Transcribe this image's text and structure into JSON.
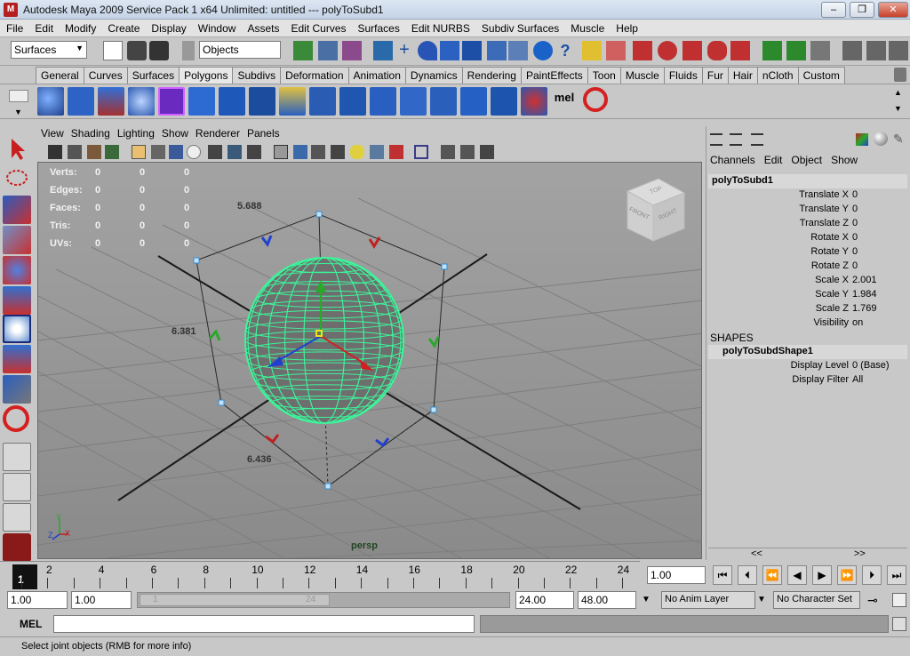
{
  "window": {
    "title": "Autodesk Maya 2009 Service Pack 1 x64 Unlimited: untitled   ---   polyToSubd1",
    "controls": [
      "–",
      "❒",
      "✕"
    ]
  },
  "menubar": [
    "File",
    "Edit",
    "Modify",
    "Create",
    "Display",
    "Window",
    "Assets",
    "Edit Curves",
    "Surfaces",
    "Edit NURBS",
    "Subdiv Surfaces",
    "Muscle",
    "Help"
  ],
  "statusline": {
    "menuset": "Surfaces",
    "selection_mode": "Objects"
  },
  "shelf": {
    "tabs": [
      "General",
      "Curves",
      "Surfaces",
      "Polygons",
      "Subdivs",
      "Deformation",
      "Animation",
      "Dynamics",
      "Rendering",
      "PaintEffects",
      "Toon",
      "Muscle",
      "Fluids",
      "Fur",
      "Hair",
      "nCloth",
      "Custom"
    ],
    "active_tab": "Polygons",
    "mel_label": "mel"
  },
  "viewport": {
    "menus": [
      "View",
      "Shading",
      "Lighting",
      "Show",
      "Renderer",
      "Panels"
    ],
    "hud": {
      "rows": [
        {
          "label": "Verts:",
          "values": [
            "0",
            "0",
            "0"
          ]
        },
        {
          "label": "Edges:",
          "values": [
            "0",
            "0",
            "0"
          ]
        },
        {
          "label": "Faces:",
          "values": [
            "0",
            "0",
            "0"
          ]
        },
        {
          "label": "Tris:",
          "values": [
            "0",
            "0",
            "0"
          ]
        },
        {
          "label": "UVs:",
          "values": [
            "0",
            "0",
            "0"
          ]
        }
      ]
    },
    "dimensions": {
      "width": "5.688",
      "height": "6.381",
      "depth": "6.436"
    },
    "camera_name": "persp",
    "viewcube": {
      "top": "TOP",
      "front": "FRONT",
      "right": "RIGHT"
    },
    "axis": {
      "x": "X",
      "y": "Y",
      "z": "Z"
    }
  },
  "channelbox": {
    "menus": [
      "Channels",
      "Edit",
      "Object",
      "Show"
    ],
    "node": "polyToSubd1",
    "attributes": [
      {
        "label": "Translate X",
        "value": "0"
      },
      {
        "label": "Translate Y",
        "value": "0"
      },
      {
        "label": "Translate Z",
        "value": "0"
      },
      {
        "label": "Rotate X",
        "value": "0"
      },
      {
        "label": "Rotate Y",
        "value": "0"
      },
      {
        "label": "Rotate Z",
        "value": "0"
      },
      {
        "label": "Scale X",
        "value": "2.001"
      },
      {
        "label": "Scale Y",
        "value": "1.984"
      },
      {
        "label": "Scale Z",
        "value": "1.769"
      },
      {
        "label": "Visibility",
        "value": "on"
      }
    ],
    "shapes_header": "SHAPES",
    "shape_node": "polyToSubdShape1",
    "shape_attributes": [
      {
        "label": "Display Level",
        "value": "0 (Base)"
      },
      {
        "label": "Display Filter",
        "value": "All"
      }
    ],
    "nav_left": "<<",
    "nav_right": ">>"
  },
  "timeline": {
    "ticks": [
      "2",
      "4",
      "6",
      "8",
      "10",
      "12",
      "14",
      "16",
      "18",
      "20",
      "22",
      "24"
    ],
    "current_frame_label": "1",
    "current_time": "1.00"
  },
  "range": {
    "start": "1.00",
    "playback_start": "1.00",
    "slider_left": "1",
    "slider_right": "24",
    "playback_end": "24.00",
    "end": "48.00",
    "anim_layer": "No Anim Layer",
    "character_set": "No Character Set"
  },
  "commandline": {
    "label": "MEL"
  },
  "helpline": {
    "text": "Select joint objects (RMB for more info)"
  },
  "colors": {
    "wire": "#3cf59a",
    "sphere": "#6e6e6e",
    "viewport_top": "#a3a3a3",
    "grid": "#7a7a7a"
  }
}
